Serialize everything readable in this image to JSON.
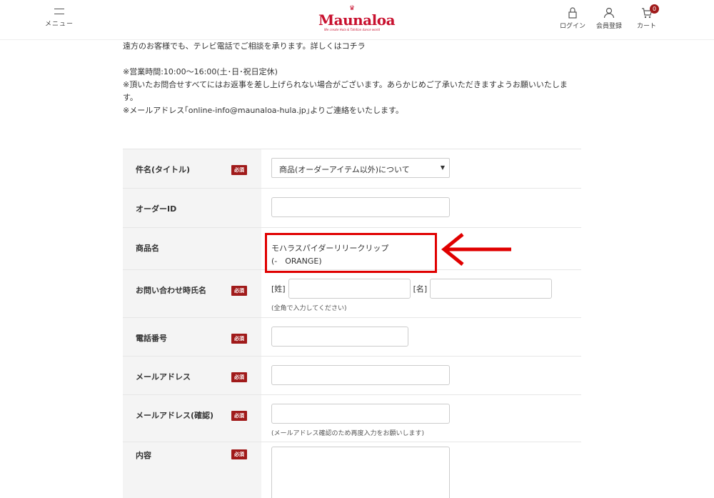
{
  "header": {
    "menu_label": "メニュー",
    "logo_text": "Maunaloa",
    "logo_tagline": "We create Hula & Tahitian dance world",
    "login_label": "ログイン",
    "register_label": "会員登録",
    "cart_label": "カート",
    "cart_count": "0"
  },
  "notes": {
    "line1": "遠方のお客様でも、テレビ電話でご相談を承ります。詳しくはコチラ",
    "line2": "※営業時間:10:00〜16:00(土･日･祝日定休)",
    "line3": "※頂いたお問合せすべてにはお返事を差し上げられない場合がございます。あらかじめご了承いただきますようお願いいたしま",
    "line4": "す。",
    "line5": "※メールアドレス｢online-info@maunaloa-hula.jp｣よりご連絡をいたします。"
  },
  "form": {
    "required_label": "必須",
    "subject": {
      "label": "件名(タイトル)",
      "value": "商品(オーダーアイテム以外)について"
    },
    "order_id": {
      "label": "オーダーID"
    },
    "product": {
      "label": "商品名",
      "line1": "モハラスパイダーリリークリップ",
      "line2": "(-　ORANGE)"
    },
    "name": {
      "label": "お問い合わせ時氏名",
      "sei": "[姓]",
      "mei": "[名]",
      "hint": "(全角で入力してください)"
    },
    "phone": {
      "label": "電話番号"
    },
    "email": {
      "label": "メールアドレス"
    },
    "email_confirm": {
      "label": "メールアドレス(確認)",
      "hint": "(メールアドレス確認のため再度入力をお願いします)"
    },
    "content": {
      "label": "内容"
    }
  },
  "colors": {
    "brand_red": "#c8102e",
    "badge_red": "#a01a1a",
    "annotation_red": "#e00000"
  },
  "icons": [
    "menu-icon",
    "lock-icon",
    "user-icon",
    "cart-icon",
    "arrow-left-icon"
  ]
}
